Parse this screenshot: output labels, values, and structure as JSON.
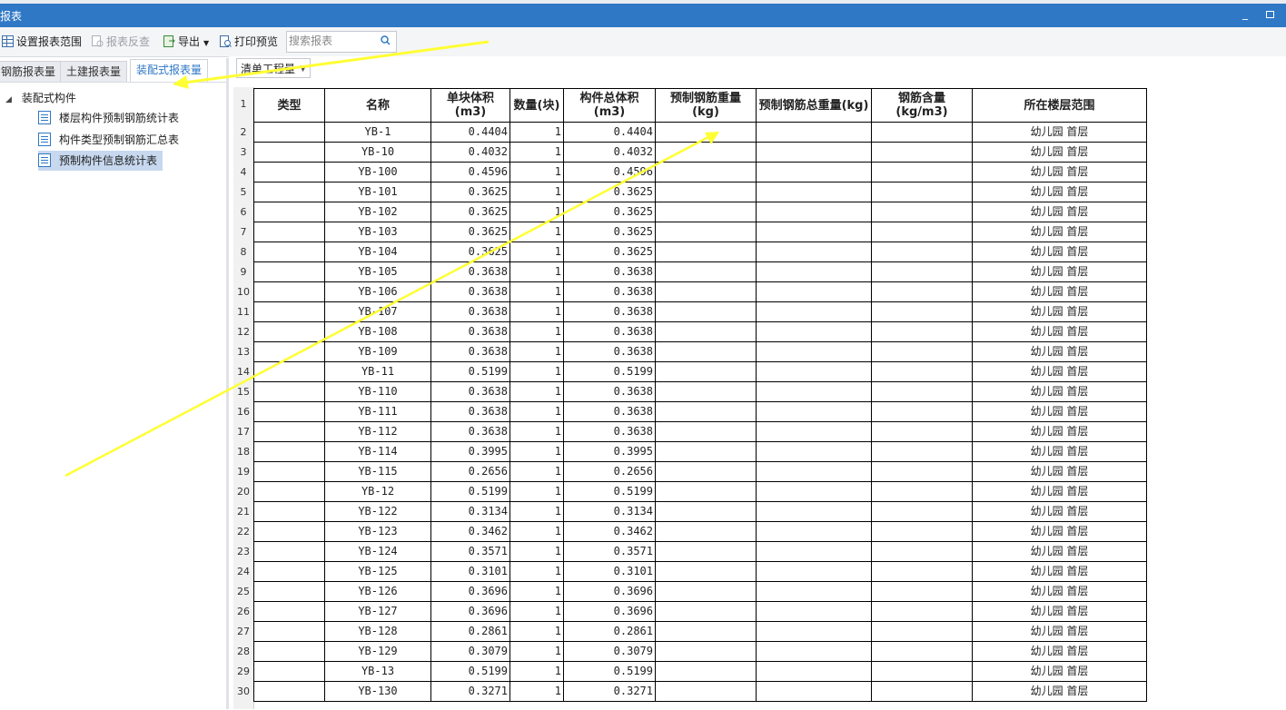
{
  "window": {
    "title": "报表",
    "minimize_glyph": "_"
  },
  "toolbar": {
    "set_range": "设置报表范围",
    "reverse_check": "报表反查",
    "export": "导出",
    "print_preview": "打印预览",
    "search_placeholder": "搜索报表"
  },
  "tabs": [
    {
      "label": "钢筋报表量",
      "active": false
    },
    {
      "label": "土建报表量",
      "active": false
    },
    {
      "label": "装配式报表量",
      "active": true
    }
  ],
  "tree": {
    "root": "装配式构件",
    "items": [
      {
        "label": "楼层构件预制钢筋统计表",
        "selected": false
      },
      {
        "label": "构件类型预制钢筋汇总表",
        "selected": false
      },
      {
        "label": "预制构件信息统计表",
        "selected": true
      }
    ]
  },
  "sheet": {
    "view_select": "清单工程量",
    "row_numbers": [
      "1",
      "2",
      "3",
      "4",
      "5",
      "6",
      "7",
      "8",
      "9",
      "10",
      "11",
      "12",
      "13",
      "14",
      "15",
      "16",
      "17",
      "18",
      "19",
      "20",
      "21",
      "22",
      "23",
      "24",
      "25",
      "26",
      "27",
      "28",
      "29",
      "30"
    ],
    "headers": [
      "类型",
      "名称",
      "单块体积(m3)",
      "数量(块)",
      "构件总体积(m3)",
      "预制钢筋重量(kg)",
      "预制钢筋总重量(kg)",
      "钢筋含量(kg/m3)",
      "所在楼层范围"
    ],
    "rows": [
      {
        "name": "YB-1",
        "unit_volume": "0.4404",
        "qty": "1",
        "total_volume": "0.4404",
        "floor": "幼儿园 首层"
      },
      {
        "name": "YB-10",
        "unit_volume": "0.4032",
        "qty": "1",
        "total_volume": "0.4032",
        "floor": "幼儿园 首层"
      },
      {
        "name": "YB-100",
        "unit_volume": "0.4596",
        "qty": "1",
        "total_volume": "0.4596",
        "floor": "幼儿园 首层"
      },
      {
        "name": "YB-101",
        "unit_volume": "0.3625",
        "qty": "1",
        "total_volume": "0.3625",
        "floor": "幼儿园 首层"
      },
      {
        "name": "YB-102",
        "unit_volume": "0.3625",
        "qty": "1",
        "total_volume": "0.3625",
        "floor": "幼儿园 首层"
      },
      {
        "name": "YB-103",
        "unit_volume": "0.3625",
        "qty": "1",
        "total_volume": "0.3625",
        "floor": "幼儿园 首层"
      },
      {
        "name": "YB-104",
        "unit_volume": "0.3625",
        "qty": "1",
        "total_volume": "0.3625",
        "floor": "幼儿园 首层"
      },
      {
        "name": "YB-105",
        "unit_volume": "0.3638",
        "qty": "1",
        "total_volume": "0.3638",
        "floor": "幼儿园 首层"
      },
      {
        "name": "YB-106",
        "unit_volume": "0.3638",
        "qty": "1",
        "total_volume": "0.3638",
        "floor": "幼儿园 首层"
      },
      {
        "name": "YB-107",
        "unit_volume": "0.3638",
        "qty": "1",
        "total_volume": "0.3638",
        "floor": "幼儿园 首层"
      },
      {
        "name": "YB-108",
        "unit_volume": "0.3638",
        "qty": "1",
        "total_volume": "0.3638",
        "floor": "幼儿园 首层"
      },
      {
        "name": "YB-109",
        "unit_volume": "0.3638",
        "qty": "1",
        "total_volume": "0.3638",
        "floor": "幼儿园 首层"
      },
      {
        "name": "YB-11",
        "unit_volume": "0.5199",
        "qty": "1",
        "total_volume": "0.5199",
        "floor": "幼儿园 首层"
      },
      {
        "name": "YB-110",
        "unit_volume": "0.3638",
        "qty": "1",
        "total_volume": "0.3638",
        "floor": "幼儿园 首层"
      },
      {
        "name": "YB-111",
        "unit_volume": "0.3638",
        "qty": "1",
        "total_volume": "0.3638",
        "floor": "幼儿园 首层"
      },
      {
        "name": "YB-112",
        "unit_volume": "0.3638",
        "qty": "1",
        "total_volume": "0.3638",
        "floor": "幼儿园 首层"
      },
      {
        "name": "YB-114",
        "unit_volume": "0.3995",
        "qty": "1",
        "total_volume": "0.3995",
        "floor": "幼儿园 首层"
      },
      {
        "name": "YB-115",
        "unit_volume": "0.2656",
        "qty": "1",
        "total_volume": "0.2656",
        "floor": "幼儿园 首层"
      },
      {
        "name": "YB-12",
        "unit_volume": "0.5199",
        "qty": "1",
        "total_volume": "0.5199",
        "floor": "幼儿园 首层"
      },
      {
        "name": "YB-122",
        "unit_volume": "0.3134",
        "qty": "1",
        "total_volume": "0.3134",
        "floor": "幼儿园 首层"
      },
      {
        "name": "YB-123",
        "unit_volume": "0.3462",
        "qty": "1",
        "total_volume": "0.3462",
        "floor": "幼儿园 首层"
      },
      {
        "name": "YB-124",
        "unit_volume": "0.3571",
        "qty": "1",
        "total_volume": "0.3571",
        "floor": "幼儿园 首层"
      },
      {
        "name": "YB-125",
        "unit_volume": "0.3101",
        "qty": "1",
        "total_volume": "0.3101",
        "floor": "幼儿园 首层"
      },
      {
        "name": "YB-126",
        "unit_volume": "0.3696",
        "qty": "1",
        "total_volume": "0.3696",
        "floor": "幼儿园 首层"
      },
      {
        "name": "YB-127",
        "unit_volume": "0.3696",
        "qty": "1",
        "total_volume": "0.3696",
        "floor": "幼儿园 首层"
      },
      {
        "name": "YB-128",
        "unit_volume": "0.2861",
        "qty": "1",
        "total_volume": "0.2861",
        "floor": "幼儿园 首层"
      },
      {
        "name": "YB-129",
        "unit_volume": "0.3079",
        "qty": "1",
        "total_volume": "0.3079",
        "floor": "幼儿园 首层"
      },
      {
        "name": "YB-13",
        "unit_volume": "0.5199",
        "qty": "1",
        "total_volume": "0.5199",
        "floor": "幼儿园 首层"
      },
      {
        "name": "YB-130",
        "unit_volume": "0.3271",
        "qty": "1",
        "total_volume": "0.3271",
        "floor": "幼儿园 首层"
      }
    ]
  },
  "colors": {
    "titlebar": "#2f78c6",
    "active_tab_text": "#2f78c6",
    "selected_item": "#c7d8ef",
    "annotation_arrow": "#ffff33"
  }
}
